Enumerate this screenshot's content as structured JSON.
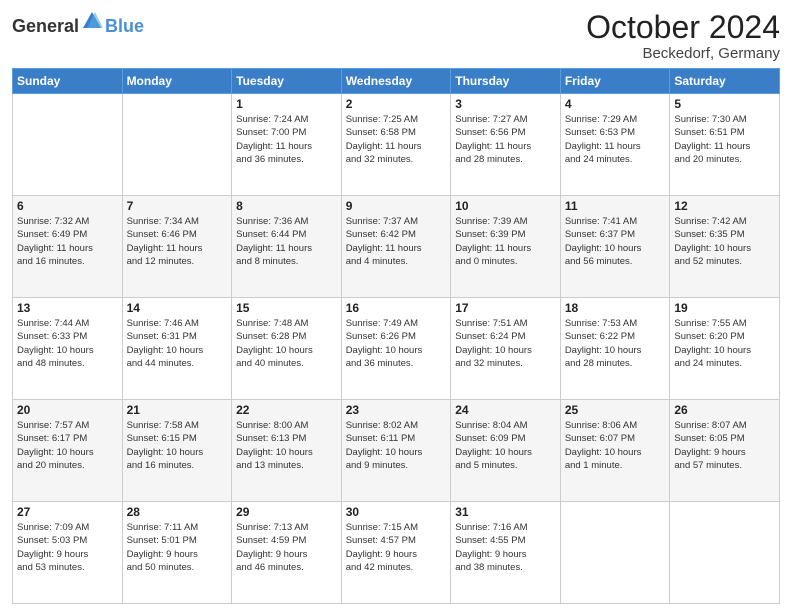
{
  "header": {
    "logo_general": "General",
    "logo_blue": "Blue",
    "month_title": "October 2024",
    "location": "Beckedorf, Germany"
  },
  "weekdays": [
    "Sunday",
    "Monday",
    "Tuesday",
    "Wednesday",
    "Thursday",
    "Friday",
    "Saturday"
  ],
  "weeks": [
    [
      {
        "day": "",
        "info": ""
      },
      {
        "day": "",
        "info": ""
      },
      {
        "day": "1",
        "info": "Sunrise: 7:24 AM\nSunset: 7:00 PM\nDaylight: 11 hours\nand 36 minutes."
      },
      {
        "day": "2",
        "info": "Sunrise: 7:25 AM\nSunset: 6:58 PM\nDaylight: 11 hours\nand 32 minutes."
      },
      {
        "day": "3",
        "info": "Sunrise: 7:27 AM\nSunset: 6:56 PM\nDaylight: 11 hours\nand 28 minutes."
      },
      {
        "day": "4",
        "info": "Sunrise: 7:29 AM\nSunset: 6:53 PM\nDaylight: 11 hours\nand 24 minutes."
      },
      {
        "day": "5",
        "info": "Sunrise: 7:30 AM\nSunset: 6:51 PM\nDaylight: 11 hours\nand 20 minutes."
      }
    ],
    [
      {
        "day": "6",
        "info": "Sunrise: 7:32 AM\nSunset: 6:49 PM\nDaylight: 11 hours\nand 16 minutes."
      },
      {
        "day": "7",
        "info": "Sunrise: 7:34 AM\nSunset: 6:46 PM\nDaylight: 11 hours\nand 12 minutes."
      },
      {
        "day": "8",
        "info": "Sunrise: 7:36 AM\nSunset: 6:44 PM\nDaylight: 11 hours\nand 8 minutes."
      },
      {
        "day": "9",
        "info": "Sunrise: 7:37 AM\nSunset: 6:42 PM\nDaylight: 11 hours\nand 4 minutes."
      },
      {
        "day": "10",
        "info": "Sunrise: 7:39 AM\nSunset: 6:39 PM\nDaylight: 11 hours\nand 0 minutes."
      },
      {
        "day": "11",
        "info": "Sunrise: 7:41 AM\nSunset: 6:37 PM\nDaylight: 10 hours\nand 56 minutes."
      },
      {
        "day": "12",
        "info": "Sunrise: 7:42 AM\nSunset: 6:35 PM\nDaylight: 10 hours\nand 52 minutes."
      }
    ],
    [
      {
        "day": "13",
        "info": "Sunrise: 7:44 AM\nSunset: 6:33 PM\nDaylight: 10 hours\nand 48 minutes."
      },
      {
        "day": "14",
        "info": "Sunrise: 7:46 AM\nSunset: 6:31 PM\nDaylight: 10 hours\nand 44 minutes."
      },
      {
        "day": "15",
        "info": "Sunrise: 7:48 AM\nSunset: 6:28 PM\nDaylight: 10 hours\nand 40 minutes."
      },
      {
        "day": "16",
        "info": "Sunrise: 7:49 AM\nSunset: 6:26 PM\nDaylight: 10 hours\nand 36 minutes."
      },
      {
        "day": "17",
        "info": "Sunrise: 7:51 AM\nSunset: 6:24 PM\nDaylight: 10 hours\nand 32 minutes."
      },
      {
        "day": "18",
        "info": "Sunrise: 7:53 AM\nSunset: 6:22 PM\nDaylight: 10 hours\nand 28 minutes."
      },
      {
        "day": "19",
        "info": "Sunrise: 7:55 AM\nSunset: 6:20 PM\nDaylight: 10 hours\nand 24 minutes."
      }
    ],
    [
      {
        "day": "20",
        "info": "Sunrise: 7:57 AM\nSunset: 6:17 PM\nDaylight: 10 hours\nand 20 minutes."
      },
      {
        "day": "21",
        "info": "Sunrise: 7:58 AM\nSunset: 6:15 PM\nDaylight: 10 hours\nand 16 minutes."
      },
      {
        "day": "22",
        "info": "Sunrise: 8:00 AM\nSunset: 6:13 PM\nDaylight: 10 hours\nand 13 minutes."
      },
      {
        "day": "23",
        "info": "Sunrise: 8:02 AM\nSunset: 6:11 PM\nDaylight: 10 hours\nand 9 minutes."
      },
      {
        "day": "24",
        "info": "Sunrise: 8:04 AM\nSunset: 6:09 PM\nDaylight: 10 hours\nand 5 minutes."
      },
      {
        "day": "25",
        "info": "Sunrise: 8:06 AM\nSunset: 6:07 PM\nDaylight: 10 hours\nand 1 minute."
      },
      {
        "day": "26",
        "info": "Sunrise: 8:07 AM\nSunset: 6:05 PM\nDaylight: 9 hours\nand 57 minutes."
      }
    ],
    [
      {
        "day": "27",
        "info": "Sunrise: 7:09 AM\nSunset: 5:03 PM\nDaylight: 9 hours\nand 53 minutes."
      },
      {
        "day": "28",
        "info": "Sunrise: 7:11 AM\nSunset: 5:01 PM\nDaylight: 9 hours\nand 50 minutes."
      },
      {
        "day": "29",
        "info": "Sunrise: 7:13 AM\nSunset: 4:59 PM\nDaylight: 9 hours\nand 46 minutes."
      },
      {
        "day": "30",
        "info": "Sunrise: 7:15 AM\nSunset: 4:57 PM\nDaylight: 9 hours\nand 42 minutes."
      },
      {
        "day": "31",
        "info": "Sunrise: 7:16 AM\nSunset: 4:55 PM\nDaylight: 9 hours\nand 38 minutes."
      },
      {
        "day": "",
        "info": ""
      },
      {
        "day": "",
        "info": ""
      }
    ]
  ]
}
